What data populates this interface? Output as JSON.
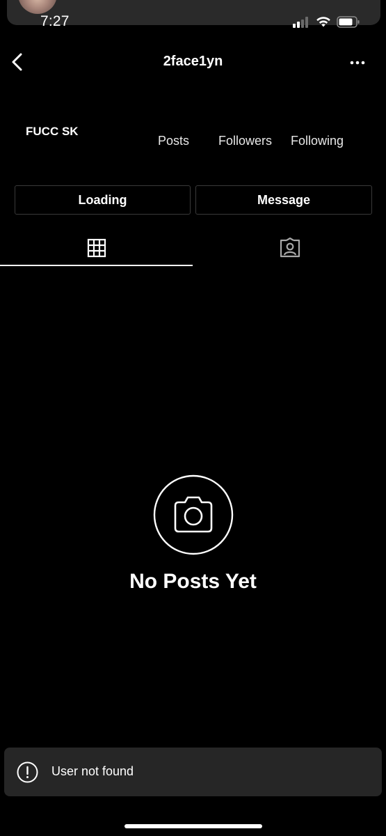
{
  "status_bar": {
    "time": "7:27",
    "signal_icon": "cellular-signal-icon",
    "wifi_icon": "wifi-icon",
    "battery_icon": "battery-icon"
  },
  "header": {
    "username": "2face1yn",
    "back_icon": "chevron-left-icon",
    "more_icon": "more-horizontal-icon"
  },
  "profile": {
    "display_name": "FUCC SK",
    "stats": {
      "posts_label": "Posts",
      "followers_label": "Followers",
      "following_label": "Following"
    }
  },
  "actions": {
    "follow_label": "Loading",
    "message_label": "Message"
  },
  "tabs": [
    {
      "name": "grid",
      "icon": "grid-icon",
      "active": true
    },
    {
      "name": "tagged",
      "icon": "tagged-person-icon",
      "active": false
    }
  ],
  "empty_state": {
    "icon": "camera-icon",
    "title": "No Posts Yet"
  },
  "toast": {
    "icon": "alert-circle-icon",
    "message": "User not found"
  },
  "colors": {
    "background": "#000000",
    "text": "#ffffff",
    "button_border": "#3a3a3a",
    "toast_background": "#262626",
    "inactive_icon": "#a8a8a8"
  }
}
